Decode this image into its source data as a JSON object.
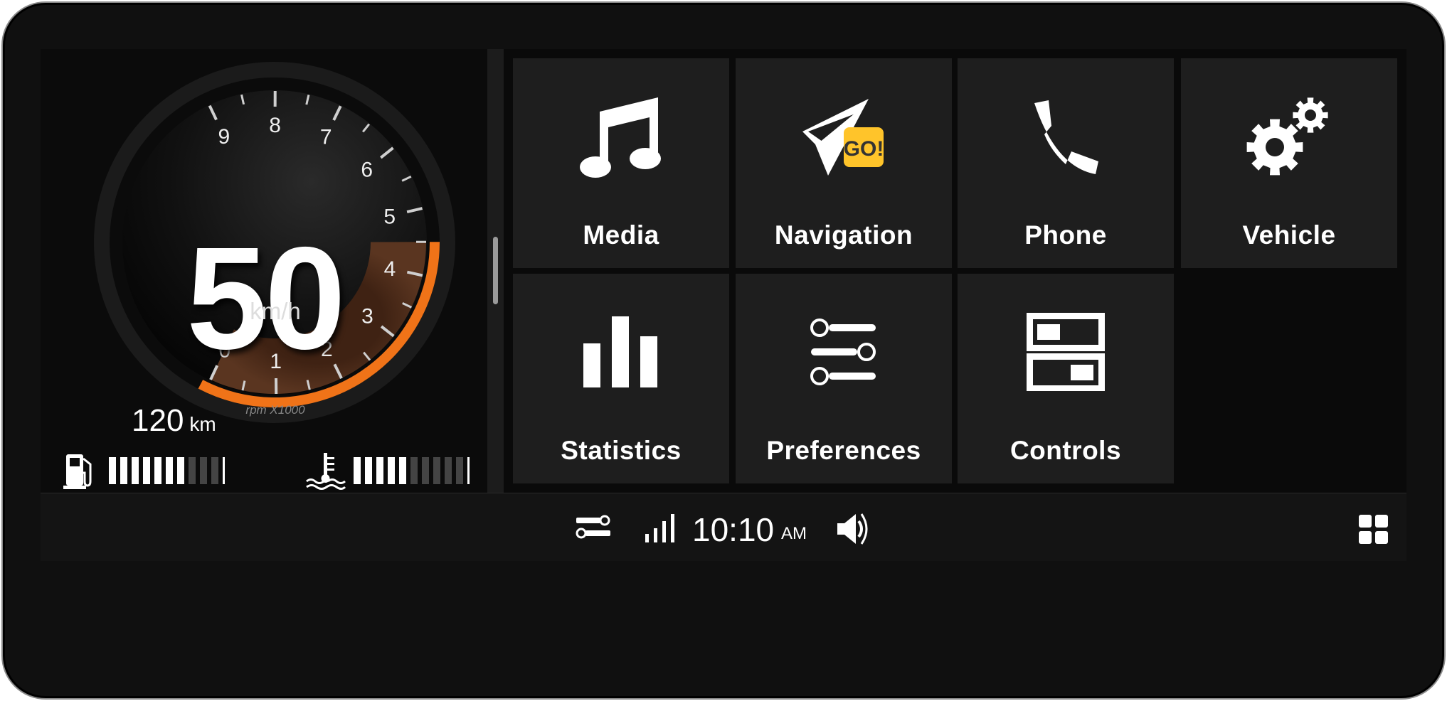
{
  "cluster": {
    "speed": "50",
    "speed_unit": "km/h",
    "rpm_label": "rpm X1000",
    "rpm_value": 4.5,
    "rpm_ticks": [
      "0",
      "1",
      "2",
      "3",
      "4",
      "5",
      "6",
      "7",
      "8",
      "9"
    ],
    "odometer_value": "120",
    "odometer_unit": "km",
    "fuel_level_bars": 7,
    "fuel_total_bars": 10,
    "temp_level_bars": 5,
    "temp_total_bars": 10,
    "accent_color": "#f07318"
  },
  "tiles": [
    {
      "label": "Media",
      "icon": "music-note-icon"
    },
    {
      "label": "Navigation",
      "icon": "navigation-go-icon",
      "badge": "GO!"
    },
    {
      "label": "Phone",
      "icon": "phone-icon"
    },
    {
      "label": "Vehicle",
      "icon": "gears-icon"
    },
    {
      "label": "Statistics",
      "icon": "bar-chart-icon"
    },
    {
      "label": "Preferences",
      "icon": "sliders-icon"
    },
    {
      "label": "Controls",
      "icon": "toggles-icon"
    }
  ],
  "statusbar": {
    "time": "10:10",
    "ampm": "AM",
    "icons": [
      "sliders-icon",
      "signal-icon",
      "volume-icon",
      "grid-icon"
    ]
  },
  "colors": {
    "badge": "#ffc42a",
    "tile_bg": "#1e1e1e"
  }
}
